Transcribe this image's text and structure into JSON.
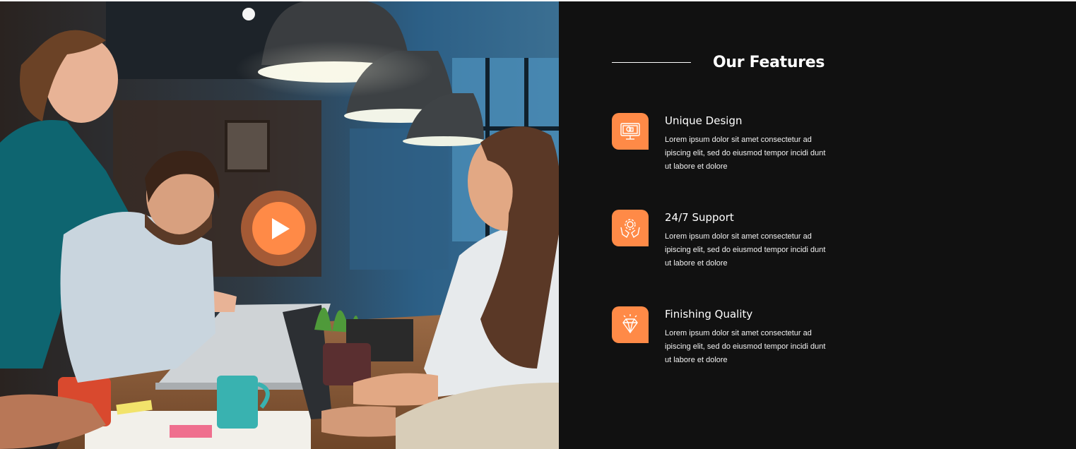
{
  "video": {
    "photo_description_icon": "office-team-photo",
    "play_icon": "play-icon"
  },
  "section": {
    "title": "Our Features"
  },
  "features": [
    {
      "icon": "monitor-design-icon",
      "title": "Unique Design",
      "description": "Lorem ipsum dolor sit amet consectetur ad ipiscing elit, sed do eiusmod tempor incidi dunt ut labore et dolore"
    },
    {
      "icon": "hands-gear-support-icon",
      "title": "24/7 Support",
      "description": "Lorem ipsum dolor sit amet consectetur ad ipiscing elit, sed do eiusmod tempor incidi dunt ut labore et dolore"
    },
    {
      "icon": "diamond-quality-icon",
      "title": "Finishing Quality",
      "description": "Lorem ipsum dolor sit amet consectetur ad ipiscing elit, sed do eiusmod tempor incidi dunt ut labore et dolore"
    }
  ],
  "colors": {
    "accent": "#ff8a47",
    "panel_bg": "#111111",
    "text": "#ffffff"
  }
}
